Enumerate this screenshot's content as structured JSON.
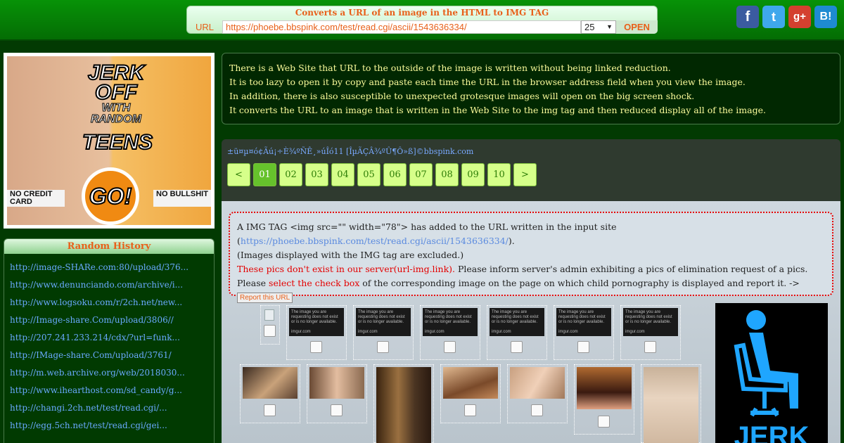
{
  "header": {
    "title": "Converts a URL of an image in the HTML to IMG TAG",
    "url_label": "URL",
    "url_value": "https://phoebe.bbspink.com/test/read.cgi/ascii/1543636334/",
    "count_value": "25",
    "open_label": "OPEN"
  },
  "social": {
    "facebook": "f",
    "twitter": "t",
    "googleplus": "g+",
    "hatena": "B!"
  },
  "banner": {
    "line1": "JERK OFF",
    "line2": "WITH RANDOM",
    "line3": "TEENS",
    "go": "GO!",
    "no_credit": "NO CREDIT CARD",
    "no_bullshit": "NO BULLSHIT"
  },
  "history": {
    "title": "Random History",
    "items": [
      "http://image-SHARe.com:80/upload/376...",
      "http://www.denunciando.com/archive/i...",
      "http://www.logsoku.com/r/2ch.net/new...",
      "http://Image-share.Com/upload/3806//",
      "http://207.241.233.214/cdx/?url=funk...",
      "http://IMage-share.Com/upload/3761/",
      "http://m.web.archive.org/web/2018030...",
      "http://www.ihearthost.com/sd_candy/g...",
      "http://changi.2ch.net/test/read.cgi/...",
      "http://egg.5ch.net/test/read.cgi/gei..."
    ]
  },
  "description": [
    "There is a Web Site that URL to the outside of the image is written without being linked reduction.",
    "It is too lazy to open it by copy and paste each time the URL in the browser address field when you view the image.",
    "In addition, there is also susceptible to unexpected grotesque images will open on the big screen shock.",
    "It converts the URL to an image that is written in the Web Site to the img tag and then reduced display all of the image."
  ],
  "thread": {
    "title": "±ü¤µ¤ó¢Ãú¡÷È¾ºÑÊ¸»úÎó11 [ÎµÃÇÂ¾ºÛ¶Ô»ß]©bbspink.com",
    "pages": [
      "<",
      "01",
      "02",
      "03",
      "04",
      "05",
      "06",
      "07",
      "08",
      "09",
      "10",
      ">"
    ],
    "current_page": "01"
  },
  "notice": {
    "line1": "A IMG TAG <img src=\"\" width=\"78\"> has added to the URL written in the input site",
    "paren_open": "(",
    "link": "https://phoebe.bbspink.com/test/read.cgi/ascii/1543636334/",
    "paren_close": ").",
    "line3": "(Images displayed with the IMG tag are excluded.)",
    "red1": "These pics don't exist in our server(url-img.link).",
    "after_red1": " Please inform server's admin exhibiting a pics of elimination request of a pics.",
    "please": "Please ",
    "red2": "select the check box",
    "after_red2": " of the corresponding image on the page on which child pornography is displayed and report it. ->",
    "report_label": "Report this URL"
  },
  "unavailable_text": "The image you are requesting does not exist or is no longer available.",
  "unavailable_brand": "imgur.com",
  "ad2": {
    "text": "JERK"
  },
  "colors": {
    "header_green": "#079207",
    "accent_orange": "#e8601a",
    "body_bg": "#023a02",
    "link_blue": "#6aa9ff",
    "notice_red": "#e40000",
    "pager_lime": "#d6ff8a"
  }
}
